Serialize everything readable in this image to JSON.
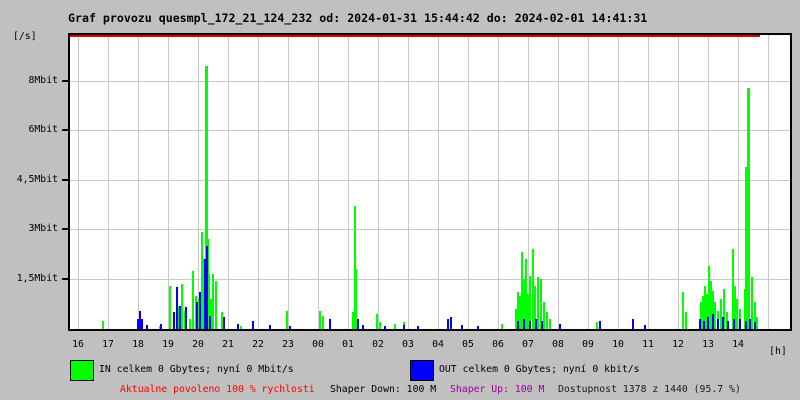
{
  "title": "Graf provozu quesmpl_172_21_124_232 od: 2024-01-31 15:44:42 do: 2024-02-01 14:41:31",
  "colors": {
    "background": "#c0c0c0",
    "plot_background": "#ffffff",
    "grid": "#c9c9c9",
    "border": "#000000",
    "limit_line": "#dd0000",
    "in_series": "#00ff00",
    "out_series": "#0000ff",
    "allowed_text": "#ff0000",
    "shaper_up_text": "#990099"
  },
  "chart_data": {
    "type": "line",
    "title": "Graf provozu quesmpl_172_21_124_232 od: 2024-01-31 15:44:42 do: 2024-02-01 14:41:31",
    "y_unit_label": "[/s]",
    "x_unit_label": "[h]",
    "y_ticks": [
      {
        "label": "8Mbit",
        "value": 8
      },
      {
        "label": "6Mbit",
        "value": 6
      },
      {
        "label": "4,5Mbit",
        "value": 4.5
      },
      {
        "label": "3Mbit",
        "value": 3
      },
      {
        "label": "1,5Mbit",
        "value": 1.5
      }
    ],
    "x_ticks": [
      "16",
      "17",
      "18",
      "19",
      "20",
      "21",
      "22",
      "23",
      "00",
      "01",
      "02",
      "03",
      "04",
      "05",
      "06",
      "07",
      "08",
      "09",
      "10",
      "11",
      "12",
      "13",
      "14"
    ],
    "x_start_hour": 16,
    "x_hours_span": 24,
    "grid": true,
    "legend_position": "bottom",
    "limit_line": {
      "value_percent": 100,
      "ends_at_hour": 38.73
    },
    "series": [
      {
        "name": "IN",
        "color": "#00ff00",
        "points": [
          [
            16.83,
            0.25
          ],
          [
            18.73,
            0.1
          ],
          [
            19.07,
            1.3
          ],
          [
            19.37,
            0.7
          ],
          [
            19.47,
            1.35
          ],
          [
            19.57,
            0.55
          ],
          [
            19.73,
            0.3
          ],
          [
            19.83,
            1.75
          ],
          [
            19.93,
            1.0
          ],
          [
            20.03,
            0.9
          ],
          [
            20.13,
            2.9
          ],
          [
            20.2,
            2.1
          ],
          [
            20.27,
            8.6,
            3
          ],
          [
            20.33,
            2.7
          ],
          [
            20.37,
            1.65
          ],
          [
            20.43,
            0.9
          ],
          [
            20.5,
            1.65
          ],
          [
            20.6,
            1.45
          ],
          [
            20.8,
            0.5
          ],
          [
            21.43,
            0.1
          ],
          [
            22.97,
            0.55
          ],
          [
            24.07,
            0.55
          ],
          [
            24.17,
            0.4
          ],
          [
            25.17,
            0.5
          ],
          [
            25.23,
            3.7
          ],
          [
            25.27,
            1.8
          ],
          [
            25.97,
            0.45
          ],
          [
            26.07,
            0.2
          ],
          [
            26.57,
            0.15
          ],
          [
            26.87,
            0.2
          ],
          [
            30.13,
            0.15
          ],
          [
            30.6,
            0.6
          ],
          [
            30.67,
            1.1
          ],
          [
            30.73,
            1.0
          ],
          [
            30.8,
            2.3
          ],
          [
            30.87,
            1.5
          ],
          [
            30.93,
            2.1
          ],
          [
            31.0,
            1.05
          ],
          [
            31.07,
            1.6
          ],
          [
            31.17,
            2.4
          ],
          [
            31.23,
            1.3
          ],
          [
            31.33,
            1.55
          ],
          [
            31.43,
            1.5
          ],
          [
            31.53,
            0.8
          ],
          [
            31.63,
            0.5
          ],
          [
            31.73,
            0.3
          ],
          [
            33.3,
            0.2
          ],
          [
            36.17,
            1.1
          ],
          [
            36.27,
            0.5
          ],
          [
            36.77,
            0.8
          ],
          [
            36.83,
            1.0
          ],
          [
            36.9,
            1.3
          ],
          [
            36.97,
            1.05
          ],
          [
            37.03,
            1.9
          ],
          [
            37.1,
            1.45
          ],
          [
            37.17,
            1.15
          ],
          [
            37.23,
            0.8
          ],
          [
            37.33,
            0.55
          ],
          [
            37.43,
            0.9
          ],
          [
            37.53,
            1.2
          ],
          [
            37.63,
            0.5
          ],
          [
            37.83,
            2.4
          ],
          [
            37.9,
            1.3
          ],
          [
            37.97,
            0.9
          ],
          [
            38.07,
            0.6
          ],
          [
            38.23,
            1.2
          ],
          [
            38.27,
            4.9
          ],
          [
            38.33,
            7.7,
            3
          ],
          [
            38.37,
            4.5
          ],
          [
            38.47,
            1.55
          ],
          [
            38.57,
            0.8
          ],
          [
            38.63,
            0.35
          ]
        ]
      },
      {
        "name": "OUT",
        "color": "#0000ff",
        "points": [
          [
            18.0,
            0.3
          ],
          [
            18.07,
            0.55
          ],
          [
            18.13,
            0.3
          ],
          [
            18.3,
            0.12
          ],
          [
            18.77,
            0.15
          ],
          [
            19.2,
            0.5
          ],
          [
            19.3,
            1.25
          ],
          [
            19.4,
            0.7
          ],
          [
            19.6,
            0.65
          ],
          [
            19.97,
            0.8
          ],
          [
            20.07,
            1.1
          ],
          [
            20.23,
            2.1
          ],
          [
            20.3,
            2.5
          ],
          [
            20.4,
            0.4
          ],
          [
            20.87,
            0.35
          ],
          [
            21.33,
            0.15
          ],
          [
            21.83,
            0.25
          ],
          [
            22.4,
            0.12
          ],
          [
            23.07,
            0.1
          ],
          [
            24.4,
            0.3
          ],
          [
            25.33,
            0.3
          ],
          [
            25.5,
            0.12
          ],
          [
            26.23,
            0.1
          ],
          [
            26.87,
            0.12
          ],
          [
            27.33,
            0.1
          ],
          [
            28.33,
            0.3
          ],
          [
            28.43,
            0.35
          ],
          [
            28.8,
            0.12
          ],
          [
            29.33,
            0.1
          ],
          [
            30.67,
            0.25
          ],
          [
            30.87,
            0.3
          ],
          [
            31.07,
            0.25
          ],
          [
            31.27,
            0.3
          ],
          [
            31.47,
            0.25
          ],
          [
            32.07,
            0.15
          ],
          [
            33.4,
            0.25
          ],
          [
            34.5,
            0.3
          ],
          [
            34.9,
            0.12
          ],
          [
            36.73,
            0.3
          ],
          [
            36.87,
            0.25
          ],
          [
            37.0,
            0.35
          ],
          [
            37.17,
            0.45
          ],
          [
            37.33,
            0.3
          ],
          [
            37.5,
            0.35
          ],
          [
            37.67,
            0.25
          ],
          [
            37.87,
            0.3
          ],
          [
            38.07,
            0.3
          ],
          [
            38.27,
            0.25
          ],
          [
            38.4,
            0.3
          ],
          [
            38.57,
            0.2
          ]
        ]
      }
    ]
  },
  "legend": {
    "in_label": "IN celkem 0 Gbytes; nyní 0 Mbit/s",
    "out_label": "OUT celkem 0 Gbytes; nyní 0 kbit/s"
  },
  "status": {
    "allowed": "Aktualne povoleno 100 % rychlosti",
    "shaper_down": "Shaper Down: 100 M",
    "shaper_up": "Shaper Up: 100 M",
    "availability": "Dostupnost 1378 z 1440 (95.7 %)"
  }
}
